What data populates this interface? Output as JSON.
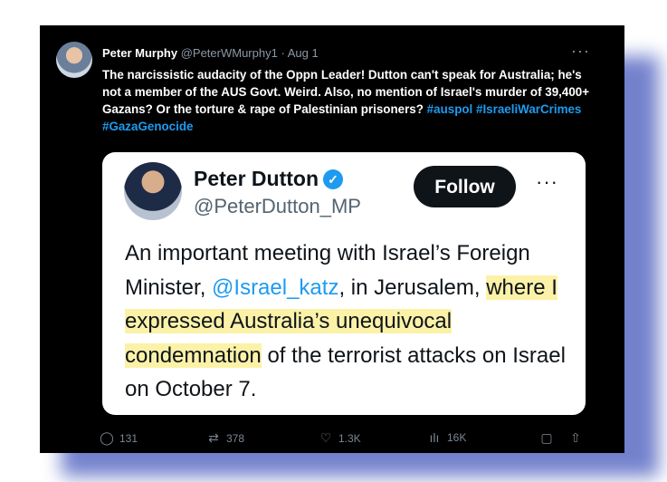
{
  "tweet": {
    "name": "Peter Murphy",
    "handle": "@PeterWMurphy1",
    "separator": "·",
    "date": "Aug 1",
    "text_main": "The narcissistic audacity of the Oppn Leader! Dutton can't speak for Australia; he's not a member of the AUS Govt. Weird. Also, no mention of Israel's murder of 39,400+ Gazans? Or the torture & rape of Palestinian prisoners?",
    "hashtags": [
      "#auspol",
      "#IsraeliWarCrimes",
      "#GazaGenocide"
    ],
    "more_icon": "more-horizontal-icon",
    "more_glyph": "···"
  },
  "quote": {
    "name": "Peter Dutton",
    "verified_icon": "verified-badge-icon",
    "verified_glyph": "✓",
    "handle": "@PeterDutton_MP",
    "follow_label": "Follow",
    "more_glyph": "···",
    "text": {
      "part1": "An important meeting with Israel’s Foreign Minister, ",
      "mention": "@Israel_katz",
      "part2": ", in Jerusalem, ",
      "highlight1": "where I expressed Australia’s unequivocal condemnation",
      "part3": " of the terrorist attacks on Israel on October 7."
    }
  },
  "actions": {
    "reply": {
      "icon": "reply-icon",
      "glyph": "◯",
      "count": "131"
    },
    "retweet": {
      "icon": "retweet-icon",
      "glyph": "⇄",
      "count": "378"
    },
    "like": {
      "icon": "heart-icon",
      "glyph": "♡",
      "count": "1.3K"
    },
    "views": {
      "icon": "analytics-icon",
      "glyph": "ılı",
      "count": "16K"
    },
    "bookmark": {
      "icon": "bookmark-icon",
      "glyph": "▢"
    },
    "share": {
      "icon": "share-icon",
      "glyph": "⇧"
    }
  },
  "colors": {
    "background": "#000000",
    "link": "#1d9bf0",
    "highlight": "#fbf2a8",
    "shadow": "#5b6cc4"
  }
}
